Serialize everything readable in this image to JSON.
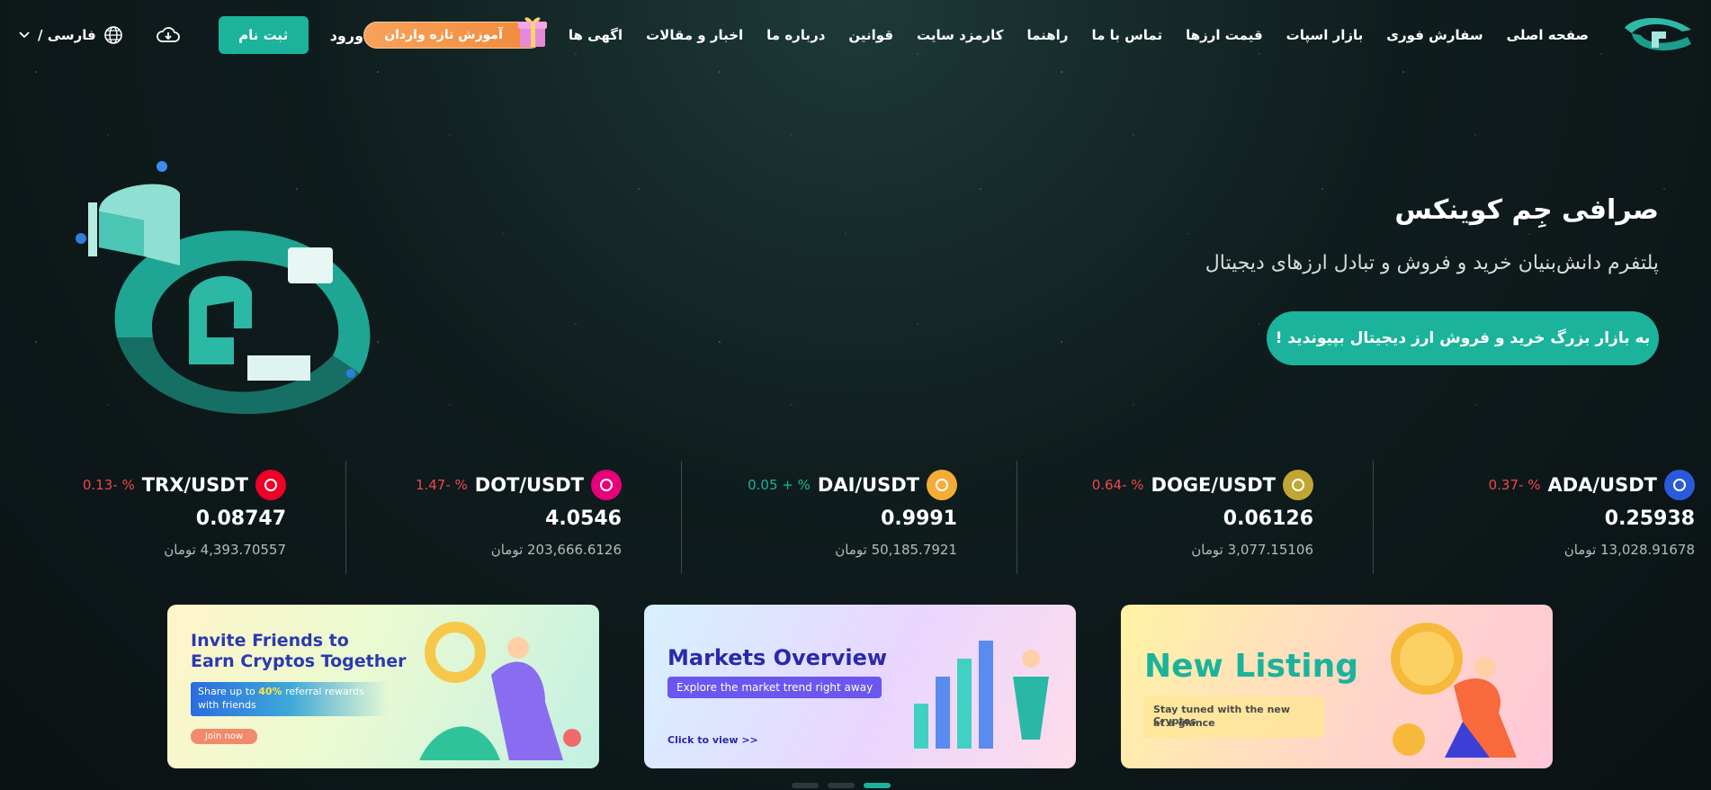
{
  "nav": {
    "links": [
      "صفحه اصلی",
      "سفارش فوری",
      "بازار اسپات",
      "قیمت ارزها",
      "تماس با ما",
      "راهنما",
      "کارمزد سایت",
      "قوانین",
      "درباره ما",
      "اخبار و مقالات",
      "اگهی ها"
    ],
    "promo_label": "آموزش تازه واردان",
    "login_label": "ورود",
    "signup_label": "ثبت نام",
    "language_label": "فارسی /"
  },
  "hero": {
    "title": "صرافی جِم کوینکس",
    "subtitle": "پلتفرم دانش‌بنیان خرید و فروش و تبادل ارزهای دیجیتال",
    "cta_label": "به بازار بزرگ خرید و فروش ارز دیجیتال بپیوندید !"
  },
  "tickers": [
    {
      "pair": "ADA/USDT",
      "change": "0.37- %",
      "direction": "down",
      "price": "0.25938",
      "toman": "13,028.91678 تومان",
      "icon": "cardano-icon",
      "color": "#2a5ada"
    },
    {
      "pair": "DOGE/USDT",
      "change": "0.64- %",
      "direction": "down",
      "price": "0.06126",
      "toman": "3,077.15106 تومان",
      "icon": "dogecoin-icon",
      "color": "#c2a633"
    },
    {
      "pair": "DAI/USDT",
      "change": "0.05 + %",
      "direction": "up",
      "price": "0.9991",
      "toman": "50,185.7921 تومان",
      "icon": "dai-icon",
      "color": "#f5ac37"
    },
    {
      "pair": "DOT/USDT",
      "change": "1.47- %",
      "direction": "down",
      "price": "4.0546",
      "toman": "203,666.6126 تومان",
      "icon": "polkadot-icon",
      "color": "#e6007a"
    },
    {
      "pair": "TRX/USDT",
      "change": "0.13- %",
      "direction": "down",
      "price": "0.08747",
      "toman": "4,393.70557 تومان",
      "icon": "tron-icon",
      "color": "#ef0027"
    }
  ],
  "banners": {
    "invite": {
      "title_1": "Invite Friends to",
      "title_2": "Earn Cryptos Together",
      "desc_pre": "Share up to ",
      "desc_pct": "40%",
      "desc_post": " referral rewards",
      "desc_2": "with friends",
      "button": "Join now"
    },
    "markets": {
      "title": "Markets Overview",
      "desc": "Explore the market trend right away",
      "link": "Click to view >>"
    },
    "listing": {
      "title": "New Listing",
      "desc_1": "Stay tuned with the new Cryptos",
      "desc_2": "at a glance"
    }
  },
  "colors": {
    "accent": "#1bb39b",
    "down": "#f0474d",
    "up": "#1bb39b",
    "promo": "#f18a3c"
  }
}
